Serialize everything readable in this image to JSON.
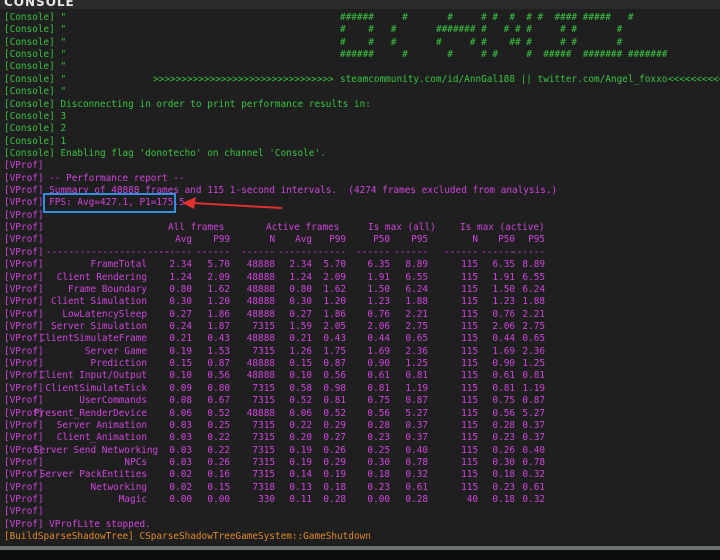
{
  "window": {
    "title": "CONSOLE"
  },
  "colors": {
    "console": "#39c341",
    "vprof": "#cf45dc",
    "shadow": "#e0892a",
    "highlight_box": "#2f8fe0",
    "arrow": "#e03030"
  },
  "console_prefix": "[Console]",
  "vprof_prefix": "[VProf]",
  "console_lines": [
    {
      "text": " \"",
      "art": "######     #       #     # #  #  # #  #### #####   #"
    },
    {
      "text": " \"",
      "art": "#    #   #       ####### #   # # #     # #       #"
    },
    {
      "text": " \"",
      "art": "#    #   #       #     # #    ## #     # #       #"
    },
    {
      "text": " \"",
      "art": "######     #       #     # #     #  #####  ####### #######"
    },
    {
      "text": " \""
    },
    {
      "text": " \"",
      "arrows_left": ">>>>>>>>>>>>>>>>>>>>>>>>>>>>>>>>",
      "art": "steamcommunity.com/id/AnnGal188 || twitter.com/Angel_foxxo",
      "arrows_right": "<<<<<<<<<<<<"
    },
    {
      "text": " \""
    },
    {
      "text": " Disconnecting in order to print performance results in:"
    },
    {
      "text": " 3"
    },
    {
      "text": " 2"
    },
    {
      "text": " 1"
    },
    {
      "text": " Enabling flag 'donotecho' on channel 'Console'."
    }
  ],
  "vprof_lines": {
    "report": " -- Performance report --",
    "summary": " Summary of 48888 frames and 115 1-second intervals.  (4274 frames excluded from analysis.)",
    "fps": " FPS: Avg=427.1, P1=175.5",
    "stopped": " VProfLite stopped."
  },
  "table": {
    "groups": [
      "All frames",
      "Active frames",
      "Is max (all)",
      "Is max (active)"
    ],
    "columns": [
      "Avg",
      "P99",
      "N",
      "Avg",
      "P99",
      "P50",
      "P95",
      "N",
      "P50",
      "P95"
    ],
    "name_dashes": "----------------------",
    "col_dashes": "------",
    "rows": [
      {
        "name": "FrameTotal",
        "values": [
          "2.34",
          "5.70",
          "48888",
          "2.34",
          "5.70",
          "6.35",
          "8.89",
          "115",
          "6.35",
          "8.89"
        ]
      },
      {
        "name": "Client Rendering",
        "values": [
          "1.24",
          "2.09",
          "48888",
          "1.24",
          "2.09",
          "1.91",
          "6.55",
          "115",
          "1.91",
          "6.55"
        ]
      },
      {
        "name": "Frame Boundary",
        "values": [
          "0.80",
          "1.62",
          "48888",
          "0.80",
          "1.62",
          "1.50",
          "6.24",
          "115",
          "1.50",
          "6.24"
        ]
      },
      {
        "name": "Client Simulation",
        "values": [
          "0.30",
          "1.20",
          "48888",
          "0.30",
          "1.20",
          "1.23",
          "1.88",
          "115",
          "1.23",
          "1.88"
        ]
      },
      {
        "name": "LowLatencySleep",
        "values": [
          "0.27",
          "1.86",
          "48888",
          "0.27",
          "1.86",
          "0.76",
          "2.21",
          "115",
          "0.76",
          "2.21"
        ]
      },
      {
        "name": "Server Simulation",
        "values": [
          "0.24",
          "1.87",
          "7315",
          "1.59",
          "2.05",
          "2.06",
          "2.75",
          "115",
          "2.06",
          "2.75"
        ]
      },
      {
        "name": "ClientSimulateFrame",
        "values": [
          "0.21",
          "0.43",
          "48888",
          "0.21",
          "0.43",
          "0.44",
          "0.65",
          "115",
          "0.44",
          "0.65"
        ]
      },
      {
        "name": "Server Game",
        "values": [
          "0.19",
          "1.53",
          "7315",
          "1.26",
          "1.75",
          "1.69",
          "2.36",
          "115",
          "1.69",
          "2.36"
        ]
      },
      {
        "name": "Prediction",
        "values": [
          "0.15",
          "0.87",
          "48888",
          "0.15",
          "0.87",
          "0.90",
          "1.25",
          "115",
          "0.90",
          "1.25"
        ]
      },
      {
        "name": "Client Input/Output",
        "values": [
          "0.10",
          "0.56",
          "48888",
          "0.10",
          "0.56",
          "0.61",
          "0.81",
          "115",
          "0.61",
          "0.81"
        ]
      },
      {
        "name": "ClientSimulateTick",
        "values": [
          "0.09",
          "0.80",
          "7315",
          "0.58",
          "0.98",
          "0.81",
          "1.19",
          "115",
          "0.81",
          "1.19"
        ]
      },
      {
        "name": "UserCommands",
        "values": [
          "0.08",
          "0.67",
          "7315",
          "0.52",
          "0.81",
          "0.75",
          "0.87",
          "115",
          "0.75",
          "0.87"
        ]
      },
      {
        "name": "Present_RenderDevice",
        "values": [
          "0.06",
          "0.52",
          "48888",
          "0.06",
          "0.52",
          "0.56",
          "5.27",
          "115",
          "0.56",
          "5.27"
        ]
      },
      {
        "name": "Server Animation",
        "values": [
          "0.03",
          "0.25",
          "7315",
          "0.22",
          "0.29",
          "0.28",
          "0.37",
          "115",
          "0.28",
          "0.37"
        ]
      },
      {
        "name": "Client_Animation",
        "values": [
          "0.03",
          "0.22",
          "7315",
          "0.20",
          "0.27",
          "0.23",
          "0.37",
          "115",
          "0.23",
          "0.37"
        ]
      },
      {
        "name": "Server Send Networking",
        "values": [
          "0.03",
          "0.22",
          "7315",
          "0.19",
          "0.26",
          "0.25",
          "0.40",
          "115",
          "0.26",
          "0.40"
        ]
      },
      {
        "name": "NPCs",
        "values": [
          "0.03",
          "0.26",
          "7315",
          "0.19",
          "0.29",
          "0.30",
          "0.78",
          "115",
          "0.30",
          "0.78"
        ]
      },
      {
        "name": "Server PackEntities",
        "values": [
          "0.02",
          "0.16",
          "7315",
          "0.14",
          "0.19",
          "0.18",
          "0.32",
          "115",
          "0.18",
          "0.32"
        ]
      },
      {
        "name": "Networking",
        "values": [
          "0.02",
          "0.15",
          "7318",
          "0.13",
          "0.18",
          "0.23",
          "0.61",
          "115",
          "0.23",
          "0.61"
        ]
      },
      {
        "name": "Magic",
        "values": [
          "0.00",
          "0.00",
          "330",
          "0.11",
          "0.28",
          "0.00",
          "0.28",
          "40",
          "0.18",
          "0.32"
        ]
      }
    ]
  },
  "shadow_line": {
    "prefix": "[BuildSparseShadowTree]",
    "text": " CSparseShadowTreeGameSystem::GameShutdown"
  }
}
